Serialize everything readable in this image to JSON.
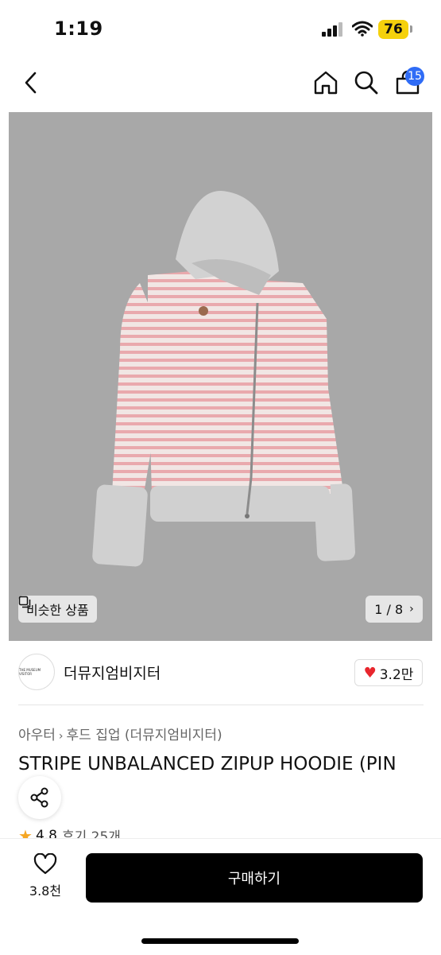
{
  "status_bar": {
    "time": "1:19",
    "battery": "76"
  },
  "header": {
    "cart_count": "15"
  },
  "gallery": {
    "similar_label": "비슷한 상품",
    "pager_text": "1 / 8"
  },
  "brand": {
    "logo_text": "THE MUSEUM VISITOR",
    "name": "더뮤지엄비지터",
    "likes": "3.2만"
  },
  "product": {
    "category": [
      "아우터",
      "후드 집업 (더뮤지엄비지터)"
    ],
    "title": "STRIPE UNBALANCED ZIPUP HOODIE (PIN",
    "rating": "4.8",
    "reviews": "후기 25개"
  },
  "bottom": {
    "wish_count": "3.8천",
    "buy_label": "구매하기"
  },
  "colors": {
    "accent": "#2f6cf6",
    "heart": "#e8262d",
    "star": "#f5a623",
    "battery": "#f5d10c"
  }
}
